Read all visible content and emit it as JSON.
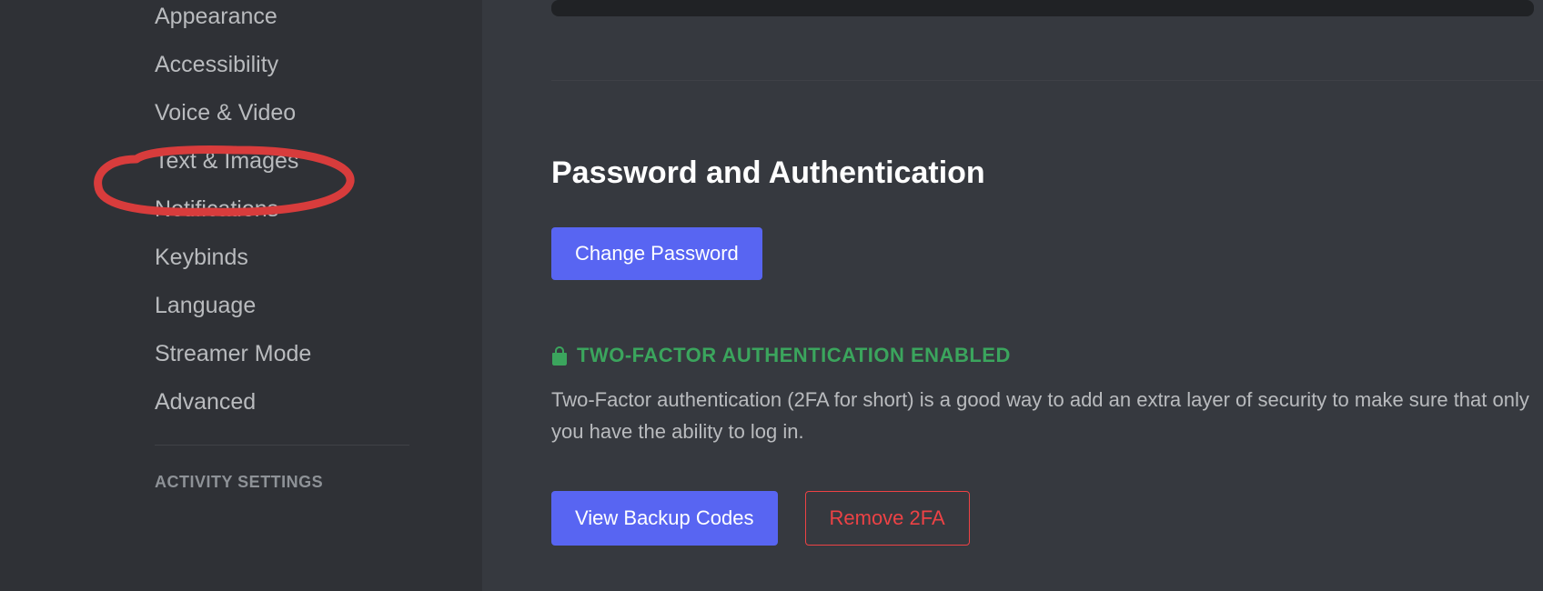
{
  "sidebar": {
    "items": [
      {
        "label": "Appearance"
      },
      {
        "label": "Accessibility"
      },
      {
        "label": "Voice & Video"
      },
      {
        "label": "Text & Images"
      },
      {
        "label": "Notifications"
      },
      {
        "label": "Keybinds"
      },
      {
        "label": "Language"
      },
      {
        "label": "Streamer Mode"
      },
      {
        "label": "Advanced"
      }
    ],
    "heading": "ACTIVITY SETTINGS"
  },
  "main": {
    "section_title": "Password and Authentication",
    "change_password_label": "Change Password",
    "twofa_status": "TWO-FACTOR AUTHENTICATION ENABLED",
    "twofa_desc": "Two-Factor authentication (2FA for short) is a good way to add an extra layer of security to make sure that only you have the ability to log in.",
    "view_backup_label": "View Backup Codes",
    "remove_2fa_label": "Remove 2FA"
  },
  "annotation": {
    "circled_item": "Text & Images"
  }
}
